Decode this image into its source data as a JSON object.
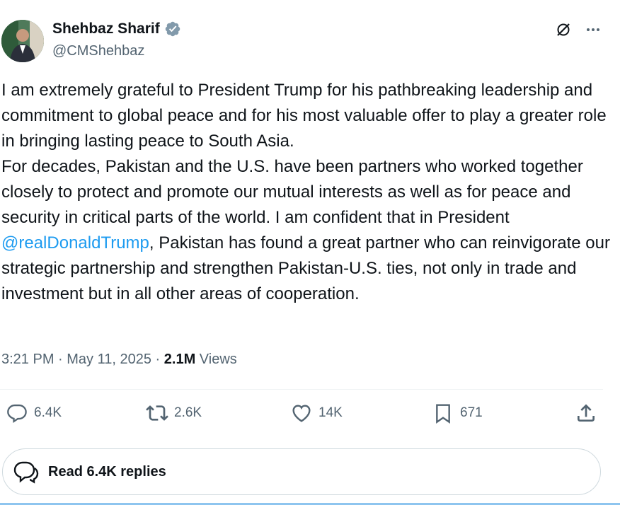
{
  "author": {
    "name": "Shehbaz Sharif",
    "handle": "@CMShehbaz",
    "verified_color": "#829aab"
  },
  "tweet": {
    "text_before_mention": "I am extremely grateful to President Trump for his pathbreaking leadership and commitment to global peace and for his most valuable offer to play a greater role in bringing lasting peace to South Asia.\nFor decades, Pakistan and the U.S. have been partners who worked together closely to protect and promote our mutual interests as well as for peace and security in critical parts of the world. I am confident that in President ",
    "mention": "@realDonaldTrump",
    "text_after_mention": ", Pakistan has found a great partner who can reinvigorate our strategic partnership and strengthen Pakistan-U.S. ties, not only in trade and investment but in all other areas of cooperation."
  },
  "meta": {
    "time": "3:21 PM",
    "date": "May 11, 2025",
    "views_count": "2.1M",
    "views_label": "Views"
  },
  "actions": {
    "replies": "6.4K",
    "reposts": "2.6K",
    "likes": "14K",
    "bookmarks": "671"
  },
  "read_replies": "Read 6.4K replies",
  "colors": {
    "accent": "#1d9bf0",
    "secondary_text": "#536471",
    "primary_text": "#0f1419"
  }
}
